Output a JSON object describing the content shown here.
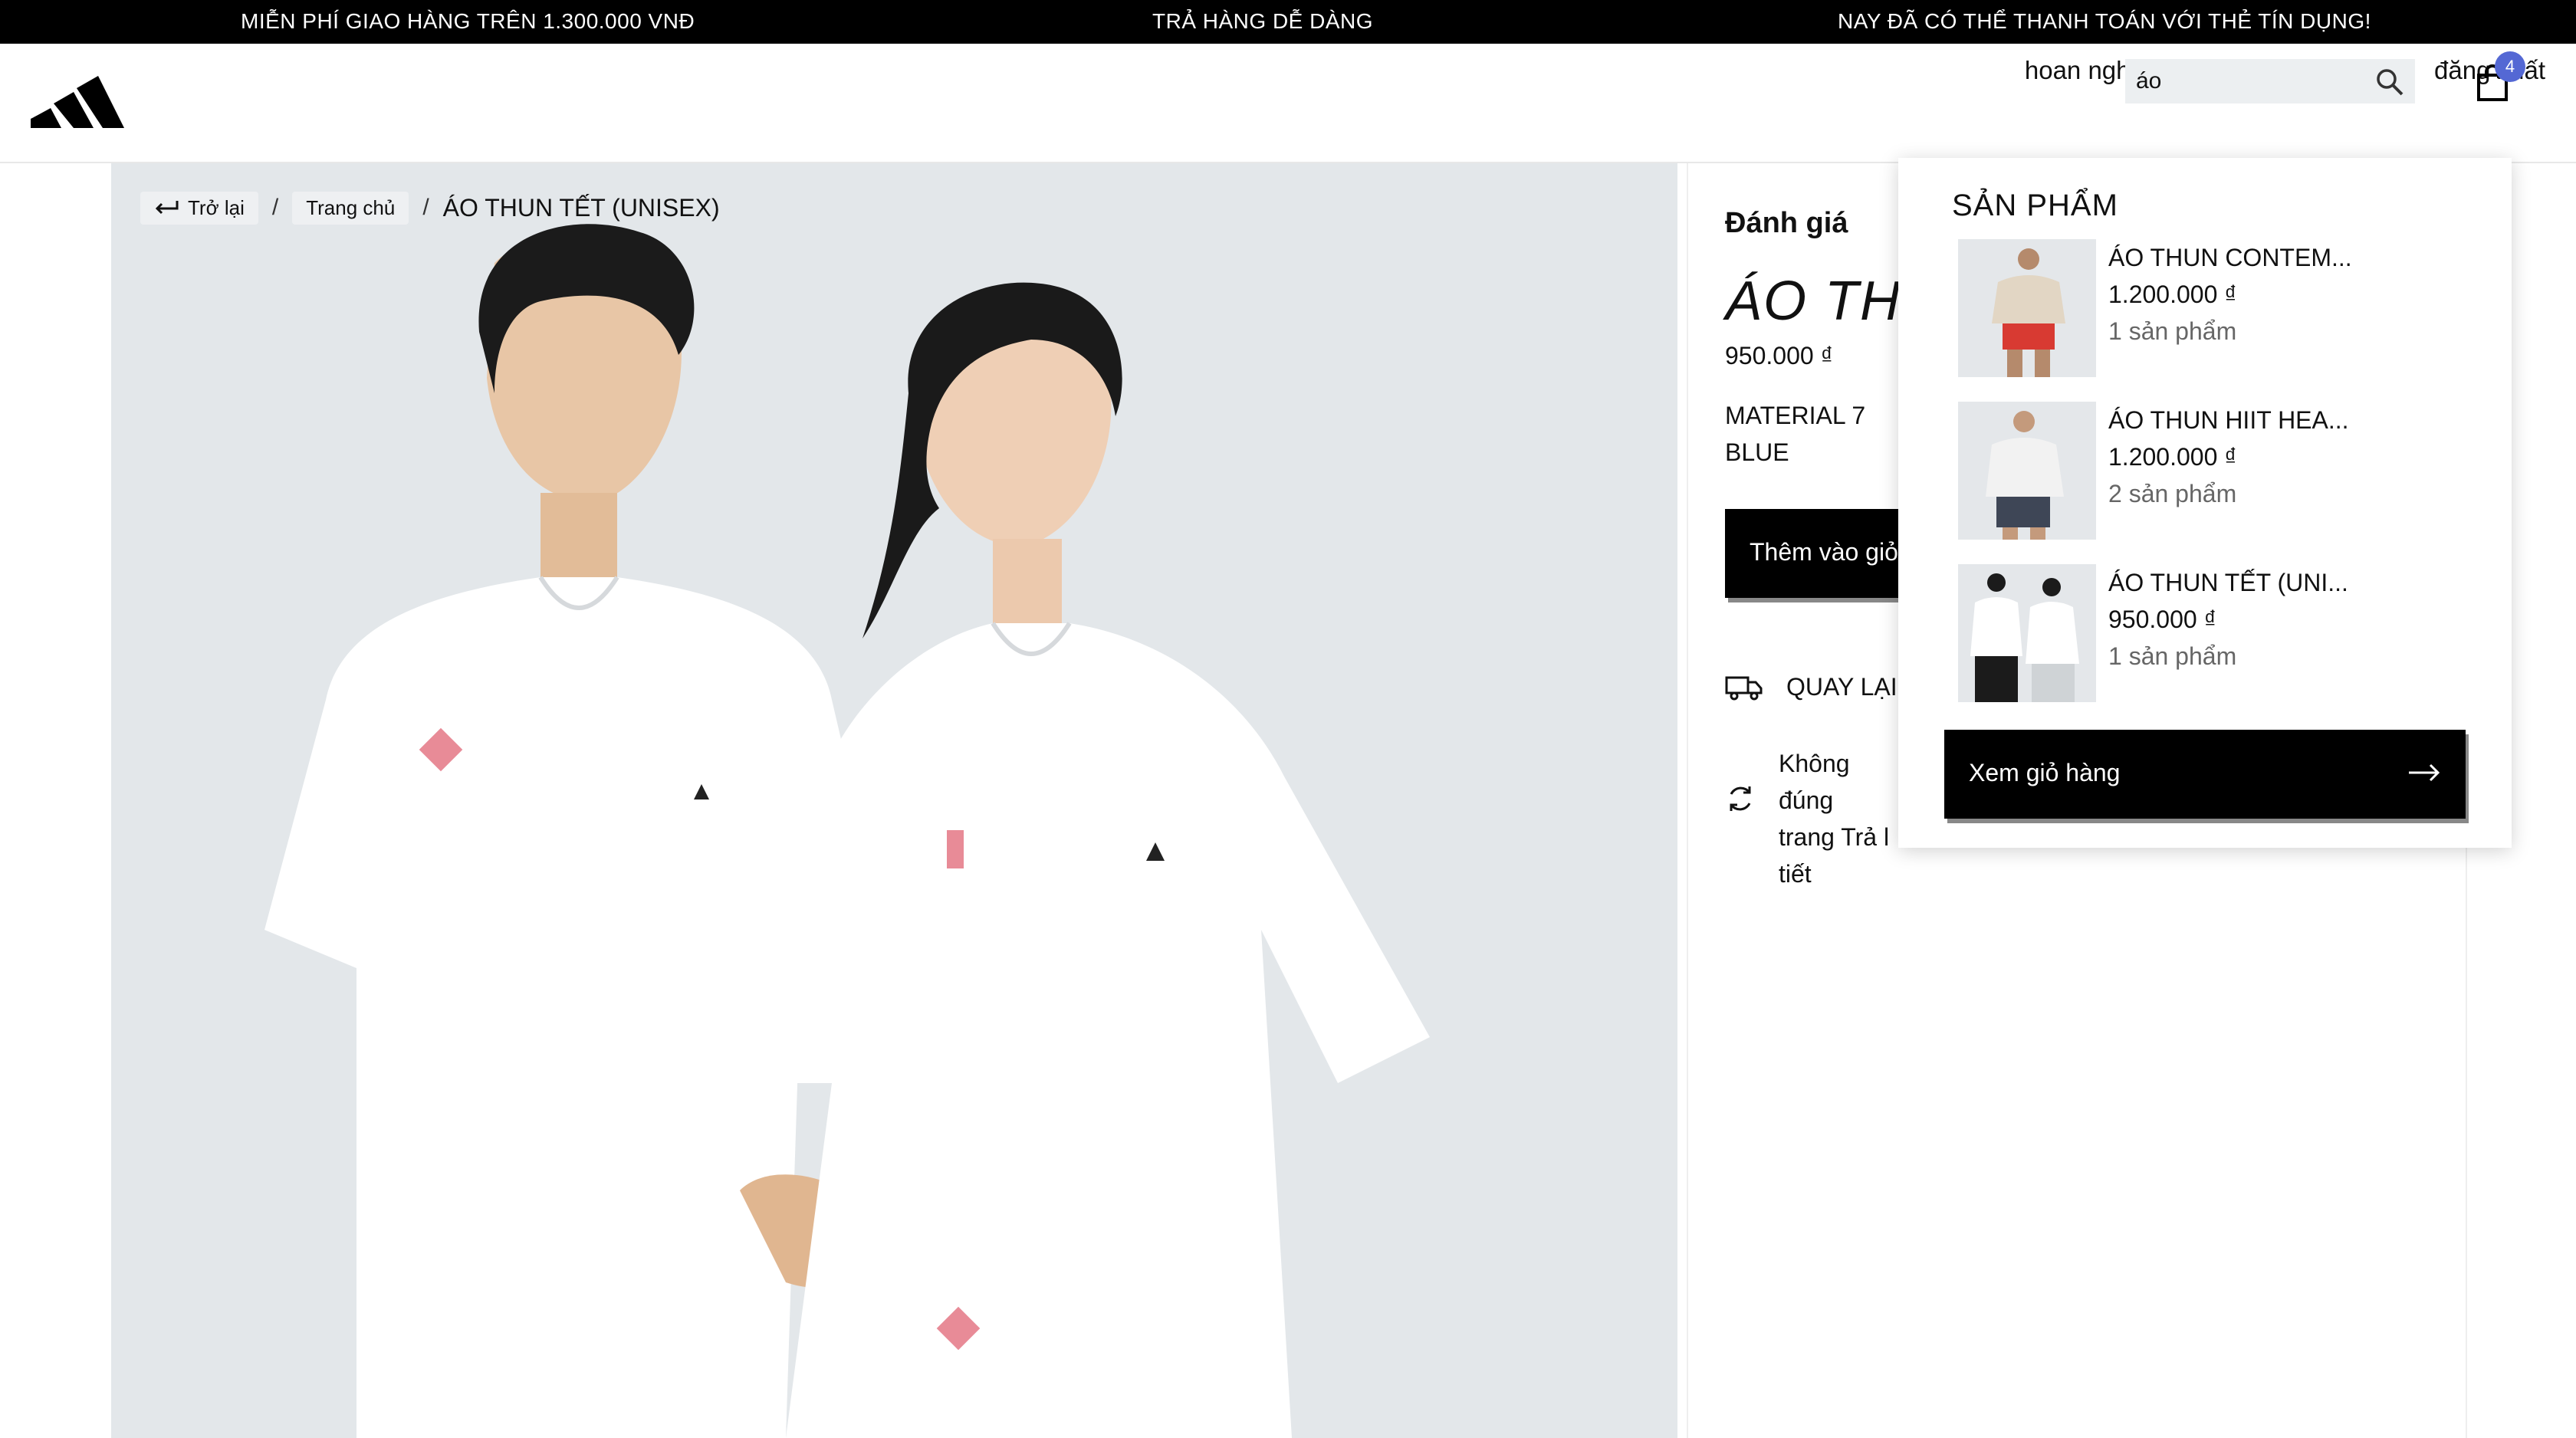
{
  "promo": {
    "left": "MIỄN PHÍ GIAO HÀNG TRÊN 1.300.000 VNĐ",
    "center": "TRẢ HÀNG DỄ DÀNG",
    "right": "NAY ĐÃ CÓ THỂ THANH TOÁN VỚI THẺ TÍN DỤNG!"
  },
  "header": {
    "welcome": "hoan nghênh bạn trở lại admin",
    "logout": "đăng xuất",
    "search_value": "áo",
    "cart_count": "4"
  },
  "breadcrumb": {
    "back": "Trở lại",
    "home": "Trang chủ",
    "current": "ÁO THUN TẾT (UNISEX)",
    "separator": "/"
  },
  "product": {
    "rating_label": "Đánh giá",
    "title": "ÁO THU",
    "price": "950.000 ₫",
    "material": "MATERIAL 7",
    "color": "BLUE",
    "add_to_cart": "Thêm vào giỏ",
    "return_label": "QUAY LẠI",
    "policy_text": "Không đúng trang Trả l tiết"
  },
  "dropdown": {
    "title": "SẢN PHẨM",
    "items": [
      {
        "name": "ÁO THUN CONTEM...",
        "price": "1.200.000 ₫",
        "qty": "1 sản phẩm"
      },
      {
        "name": "ÁO THUN HIIT HEA...",
        "price": "1.200.000 ₫",
        "qty": "2 sản phẩm"
      },
      {
        "name": "ÁO THUN TẾT (UNI...",
        "price": "950.000 ₫",
        "qty": "1 sản phẩm"
      }
    ],
    "view_cart": "Xem giỏ hàng"
  },
  "colors": {
    "promo_bg": "#000000",
    "badge": "#5468d4",
    "hero_bg": "#e3e7ea"
  },
  "icons": [
    "adidas-logo",
    "search-icon",
    "shopping-bag-icon",
    "back-arrow-icon",
    "truck-icon",
    "refresh-icon",
    "arrow-right-icon"
  ]
}
